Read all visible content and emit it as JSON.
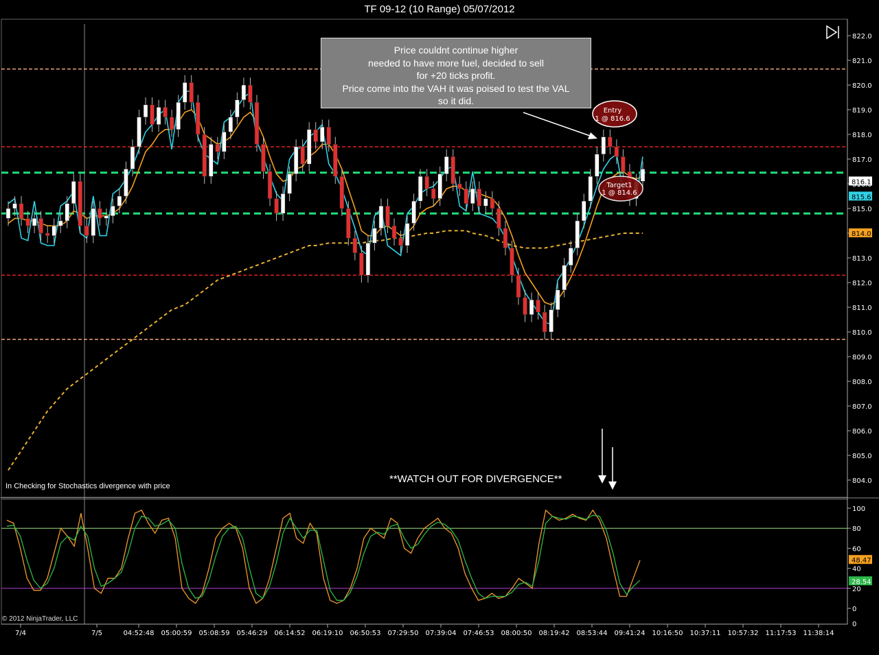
{
  "window": {
    "title": "TF 09-12 (10 Range)  05/07/2012"
  },
  "annotations": {
    "note_lines": [
      "Price couldnt continue higher",
      "needed to have more fuel, decided to sell",
      "for +20 ticks profit.",
      "Price come into the VAH it was poised to test the VAL",
      "so it did."
    ],
    "watch_out": "**WATCH OUT FOR DIVERGENCE**",
    "stoch_note": "In  Checking for Stochastics  divergence with price",
    "copyright": "© 2012 NinjaTrader, LLC",
    "entry_label": "Entry",
    "entry_detail": "1 @ 816.6",
    "target_label": "Target1",
    "target_detail": "1 @ 814.6"
  },
  "colors": {
    "up": "#ffffff",
    "down": "#e03030",
    "cyan": "#31d1e6",
    "orange": "#f5a020",
    "dashed_gold": "#e8b030",
    "red_level": "#e02020",
    "green_level": "#22e07a",
    "salmon_level": "#f0a080",
    "magenta": "#e040e0",
    "lime": "#9be040",
    "stoch_k": "#f29a2e",
    "stoch_d": "#2db84a",
    "ob_line": "#9ae07a",
    "os_line": "#b040d0"
  },
  "chart_data": [
    {
      "type": "line",
      "title": "TF 09-12 (10 Range)  05/07/2012",
      "price_range": [
        803.5,
        822.5
      ],
      "y_ticks": [
        822.0,
        821.0,
        820.0,
        819.0,
        818.0,
        817.0,
        816.0,
        815.0,
        814.0,
        813.0,
        812.0,
        811.0,
        810.0,
        809.0,
        808.0,
        807.0,
        806.0,
        805.0,
        804.0
      ],
      "x_ticks": [
        "7/4",
        "7/5",
        "04:52:48",
        "05:00:59",
        "05:08:59",
        "05:46:29",
        "06:14:52",
        "06:19:10",
        "06:50:53",
        "07:29:50",
        "07:39:04",
        "07:46:53",
        "08:00:50",
        "08:19:42",
        "08:53:44",
        "09:41:24",
        "10:16:50",
        "10:37:11",
        "10:57:32",
        "11:17:53",
        "11:38:14"
      ],
      "levels": [
        {
          "price": 820.65,
          "style": "dashed",
          "color": "salmon"
        },
        {
          "price": 817.5,
          "style": "dashed",
          "color": "red"
        },
        {
          "price": 816.45,
          "style": "dashed",
          "color": "green"
        },
        {
          "price": 814.8,
          "style": "dashed",
          "color": "green"
        },
        {
          "price": 812.3,
          "style": "dashed",
          "color": "red"
        },
        {
          "price": 809.7,
          "style": "dashed",
          "color": "salmon"
        }
      ],
      "price_labels": [
        {
          "value": "816.1",
          "bg": "#ffffff",
          "fg": "#000000"
        },
        {
          "value": "815.6",
          "bg": "#31d1e6",
          "fg": "#000000"
        },
        {
          "value": "814.0",
          "bg": "#f5a020",
          "fg": "#000000"
        }
      ],
      "series": [
        {
          "name": "",
          "values": [
            815.0,
            815.2,
            814.6,
            814.3,
            814.6,
            814.0,
            813.9,
            814.3,
            814.5,
            815.2,
            816.1,
            814.3,
            813.9,
            815.0,
            814.6,
            814.7,
            815.1,
            815.5,
            816.6,
            817.5,
            818.7,
            819.2,
            818.4,
            819.1,
            818.7,
            818.2,
            819.3,
            820.1,
            819.3,
            818.0,
            816.3,
            817.6,
            817.3,
            818.1,
            818.7,
            819.4,
            820.0,
            819.3,
            817.6,
            816.5,
            815.4,
            814.8,
            815.6,
            816.4,
            817.5,
            816.8,
            818.2,
            817.7,
            818.3,
            817.6,
            816.3,
            815.0,
            813.8,
            813.2,
            812.3,
            813.6,
            814.2,
            815.1,
            814.3,
            813.8,
            813.5,
            814.4,
            815.3,
            816.3,
            815.8,
            815.4,
            816.4,
            817.1,
            816.0,
            815.8,
            815.2,
            815.8,
            815.1,
            815.4,
            815.0,
            814.2,
            813.4,
            812.3,
            811.4,
            810.7,
            811.3,
            810.8,
            810.0,
            810.9,
            811.7,
            812.7,
            813.4,
            814.5,
            815.3,
            816.3,
            817.2,
            817.9,
            817.5,
            817.1,
            816.5,
            815.4,
            816.1,
            816.6
          ]
        },
        {
          "name": "",
          "values": [
            814.4,
            814.6,
            814.6,
            814.5,
            814.5,
            814.4,
            814.3,
            814.3,
            814.3,
            814.5,
            814.9,
            814.8,
            814.6,
            814.7,
            814.7,
            814.7,
            814.8,
            815.0,
            815.4,
            815.9,
            816.6,
            817.3,
            817.6,
            818.0,
            818.2,
            818.2,
            818.5,
            818.9,
            819.0,
            818.7,
            818.0,
            817.8,
            817.6,
            817.7,
            817.9,
            818.3,
            818.7,
            818.9,
            818.5,
            817.9,
            817.1,
            816.4,
            816.1,
            816.2,
            816.6,
            816.7,
            817.1,
            817.3,
            817.6,
            817.6,
            817.2,
            816.6,
            815.8,
            815.0,
            814.1,
            813.9,
            813.9,
            814.2,
            814.3,
            814.1,
            813.9,
            814.0,
            814.3,
            814.8,
            815.0,
            815.1,
            815.4,
            815.8,
            815.9,
            815.9,
            815.7,
            815.7,
            815.6,
            815.5,
            815.4,
            815.1,
            814.6,
            813.9,
            813.1,
            812.4,
            812.0,
            811.6,
            811.2,
            811.1,
            811.3,
            811.7,
            812.2,
            812.8,
            813.5,
            814.3,
            815.1,
            815.8,
            816.2,
            816.4,
            816.5,
            816.3,
            816.2,
            816.3
          ]
        },
        {
          "name": "",
          "values": [
            804.4,
            804.8,
            805.2,
            805.6,
            806.0,
            806.4,
            806.8,
            807.1,
            807.4,
            807.7,
            807.9,
            808.1,
            808.3,
            808.5,
            808.7,
            808.9,
            809.1,
            809.3,
            809.5,
            809.7,
            809.9,
            810.1,
            810.3,
            810.5,
            810.7,
            810.9,
            811.0,
            811.1,
            811.3,
            811.5,
            811.7,
            811.9,
            812.1,
            812.2,
            812.3,
            812.4,
            812.5,
            812.6,
            812.7,
            812.8,
            812.9,
            813.0,
            813.1,
            813.2,
            813.3,
            813.4,
            813.5,
            813.5,
            813.55,
            813.6,
            813.6,
            813.6,
            813.6,
            813.6,
            813.6,
            813.65,
            813.7,
            813.7,
            813.75,
            813.8,
            813.8,
            813.85,
            813.9,
            813.95,
            814.0,
            814.0,
            814.05,
            814.1,
            814.1,
            814.1,
            814.1,
            814.0,
            813.95,
            813.9,
            813.8,
            813.7,
            813.6,
            813.5,
            813.45,
            813.4,
            813.4,
            813.4,
            813.4,
            813.45,
            813.5,
            813.55,
            813.6,
            813.65,
            813.7,
            813.75,
            813.8,
            813.85,
            813.9,
            813.95,
            814.0,
            814.0,
            814.0,
            814.0
          ]
        }
      ]
    },
    {
      "type": "line",
      "ylim": [
        0,
        100
      ],
      "y_ticks": [
        100,
        80,
        60,
        40,
        20,
        0
      ],
      "y_axis_min_label": "0",
      "reference_lines": [
        80,
        20
      ],
      "value_labels": [
        {
          "value": "48.47",
          "bg": "#f5a020",
          "fg": "#000000"
        },
        {
          "value": "28.54",
          "bg": "#2db84a",
          "fg": "#ffffff"
        }
      ],
      "series": [
        {
          "name": "",
          "values": [
            88,
            85,
            60,
            30,
            18,
            18,
            30,
            55,
            80,
            72,
            62,
            95,
            60,
            20,
            15,
            30,
            30,
            40,
            70,
            95,
            98,
            85,
            75,
            88,
            90,
            70,
            20,
            10,
            5,
            15,
            40,
            70,
            80,
            85,
            80,
            60,
            20,
            5,
            10,
            30,
            60,
            90,
            95,
            70,
            65,
            85,
            75,
            30,
            8,
            5,
            8,
            20,
            40,
            70,
            80,
            75,
            70,
            90,
            85,
            60,
            55,
            70,
            80,
            85,
            90,
            80,
            75,
            60,
            35,
            20,
            8,
            10,
            15,
            10,
            12,
            20,
            30,
            25,
            20,
            65,
            98,
            92,
            88,
            90,
            94,
            90,
            88,
            98,
            88,
            70,
            40,
            12,
            12,
            30,
            48
          ]
        },
        {
          "name": "",
          "values": [
            82,
            83,
            72,
            48,
            28,
            20,
            25,
            40,
            65,
            72,
            68,
            82,
            72,
            40,
            22,
            25,
            30,
            36,
            55,
            80,
            92,
            90,
            82,
            84,
            88,
            80,
            45,
            20,
            10,
            12,
            28,
            52,
            72,
            80,
            82,
            70,
            40,
            15,
            10,
            22,
            45,
            75,
            90,
            80,
            70,
            78,
            78,
            48,
            18,
            8,
            8,
            16,
            32,
            55,
            72,
            76,
            74,
            82,
            84,
            70,
            60,
            64,
            74,
            82,
            86,
            84,
            78,
            68,
            48,
            30,
            15,
            10,
            12,
            12,
            12,
            16,
            24,
            26,
            22,
            48,
            85,
            92,
            90,
            89,
            92,
            91,
            89,
            93,
            92,
            78,
            55,
            25,
            14,
            22,
            28
          ]
        }
      ]
    }
  ]
}
